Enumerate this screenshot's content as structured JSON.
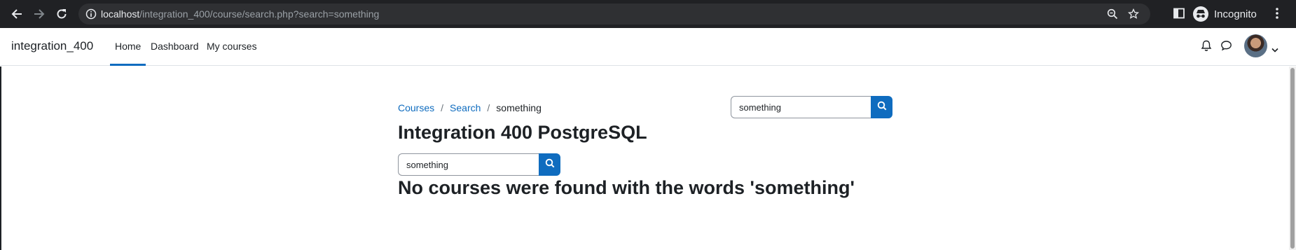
{
  "browser": {
    "url_host": "localhost",
    "url_path": "/integration_400/course/search.php?search=something",
    "profile_label": "Incognito",
    "icons": [
      "back-arrow-icon",
      "forward-arrow-icon",
      "reload-icon",
      "info-icon",
      "zoom-icon",
      "star-icon",
      "side-panel-icon",
      "incognito-icon",
      "kebab-menu-icon"
    ]
  },
  "navbar": {
    "brand": "integration_400",
    "links": [
      "Home",
      "Dashboard",
      "My courses"
    ],
    "active_link": "Home",
    "icons": [
      "bell-icon",
      "chat-icon",
      "avatar",
      "chevron-down-icon"
    ]
  },
  "breadcrumb": {
    "items": [
      "Courses",
      "Search",
      "something"
    ],
    "separator": "/"
  },
  "header_search": {
    "value": "something"
  },
  "page": {
    "title": "Integration 400 PostgreSQL",
    "search_value": "something",
    "message": "No courses were found with the words 'something'"
  },
  "colors": {
    "accent": "#0f6cbf",
    "text": "#1d2125",
    "chrome_bg": "#202124"
  }
}
